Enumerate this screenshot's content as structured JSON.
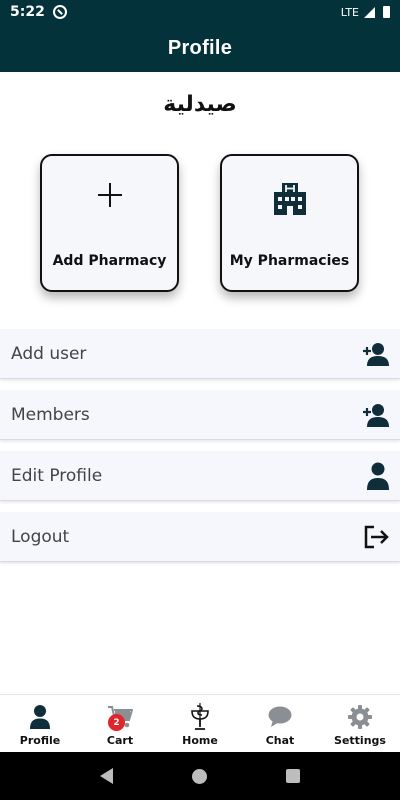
{
  "status_bar": {
    "time": "5:22",
    "network": "LTE"
  },
  "app_bar": {
    "title": "Profile"
  },
  "organization": {
    "name": "صيدلية"
  },
  "cards": {
    "add_pharmacy": {
      "label": "Add Pharmacy",
      "icon": "plus-icon"
    },
    "my_pharmacies": {
      "label": "My Pharmacies",
      "icon": "hospital-building-icon"
    }
  },
  "menu": {
    "items": [
      {
        "label": "Add user",
        "icon": "add-user-icon"
      },
      {
        "label": "Members",
        "icon": "add-user-icon"
      },
      {
        "label": "Edit Profile",
        "icon": "user-icon"
      },
      {
        "label": "Logout",
        "icon": "logout-icon"
      }
    ]
  },
  "bottom_nav": {
    "items": [
      {
        "label": "Profile",
        "icon": "user-icon",
        "active": true
      },
      {
        "label": "Cart",
        "icon": "cart-icon",
        "badge": "2"
      },
      {
        "label": "Home",
        "icon": "pharmacy-symbol-icon"
      },
      {
        "label": "Chat",
        "icon": "chat-bubble-icon"
      },
      {
        "label": "Settings",
        "icon": "gear-icon"
      }
    ]
  },
  "colors": {
    "primary": "#04323a",
    "icon": "#0f2e3a",
    "inactive_icon": "#8a8f94",
    "badge": "#e0252b",
    "row_bg": "#f6f7fc"
  }
}
